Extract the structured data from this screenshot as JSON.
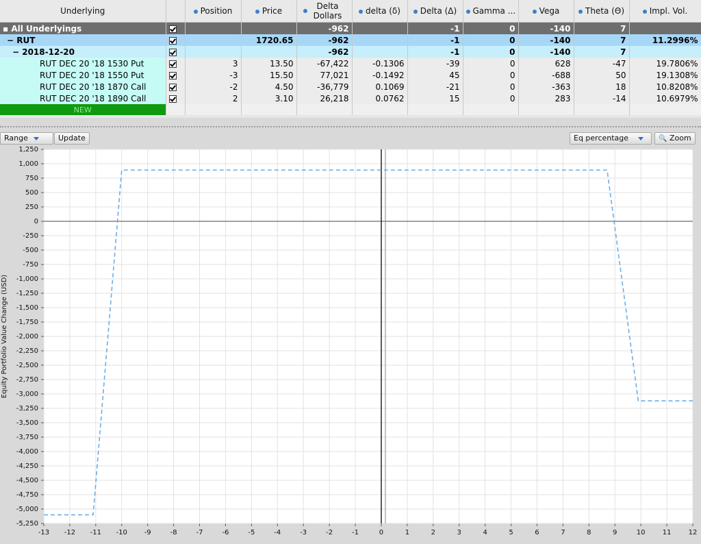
{
  "columns": [
    "Underlying",
    "",
    "Position",
    "Price",
    "Delta Dollars",
    "delta (δ)",
    "Delta (Δ)",
    "Gamma ...",
    "Vega",
    "Theta (Θ)",
    "Impl. Vol."
  ],
  "rows": {
    "all": {
      "label": "All Underlyings",
      "position": "",
      "price": "",
      "delta_dollars": "-962",
      "delta_small": "",
      "delta_cap": "-1",
      "gamma": "0",
      "vega": "-140",
      "theta": "7",
      "iv": ""
    },
    "rut": {
      "label": "RUT",
      "position": "",
      "price": "1720.65",
      "delta_dollars": "-962",
      "delta_small": "",
      "delta_cap": "-1",
      "gamma": "0",
      "vega": "-140",
      "theta": "7",
      "iv": "11.2996%"
    },
    "expiry": {
      "label": "2018-12-20",
      "position": "",
      "price": "",
      "delta_dollars": "-962",
      "delta_small": "",
      "delta_cap": "-1",
      "gamma": "0",
      "vega": "-140",
      "theta": "7",
      "iv": ""
    },
    "legs": [
      {
        "label": "RUT DEC 20 '18 1530 Put",
        "position": "3",
        "price": "13.50",
        "delta_dollars": "-67,422",
        "delta_small": "-0.1306",
        "delta_cap": "-39",
        "gamma": "0",
        "vega": "628",
        "theta": "-47",
        "iv": "19.7806%"
      },
      {
        "label": "RUT DEC 20 '18 1550 Put",
        "position": "-3",
        "price": "15.50",
        "delta_dollars": "77,021",
        "delta_small": "-0.1492",
        "delta_cap": "45",
        "gamma": "0",
        "vega": "-688",
        "theta": "50",
        "iv": "19.1308%"
      },
      {
        "label": "RUT DEC 20 '18 1870 Call",
        "position": "-2",
        "price": "4.50",
        "delta_dollars": "-36,779",
        "delta_small": "0.1069",
        "delta_cap": "-21",
        "gamma": "0",
        "vega": "-363",
        "theta": "18",
        "iv": "10.8208%"
      },
      {
        "label": "RUT DEC 20 '18 1890 Call",
        "position": "2",
        "price": "3.10",
        "delta_dollars": "26,218",
        "delta_small": "0.0762",
        "delta_cap": "15",
        "gamma": "0",
        "vega": "283",
        "theta": "-14",
        "iv": "10.6979%"
      }
    ],
    "new_label": "NEW"
  },
  "toolbar": {
    "range_label": "Range",
    "update_label": "Update",
    "mode_label": "Eq percentage",
    "zoom_label": "Zoom"
  },
  "chart_data": {
    "type": "line",
    "ylabel": "Equity Portfolio Value Change (USD)",
    "xlabel": "",
    "xlim": [
      -13,
      12
    ],
    "ylim": [
      -5250,
      1250
    ],
    "xticks": [
      -13,
      -12,
      -11,
      -10,
      -9,
      -8,
      -7,
      -6,
      -5,
      -4,
      -3,
      -2,
      -1,
      0,
      1,
      2,
      3,
      4,
      5,
      6,
      7,
      8,
      9,
      10,
      11,
      12
    ],
    "yticks": [
      1250,
      1000,
      750,
      500,
      250,
      0,
      -250,
      -500,
      -750,
      -1000,
      -1250,
      -1500,
      -1750,
      -2000,
      -2250,
      -2500,
      -2750,
      -3000,
      -3250,
      -3500,
      -3750,
      -4000,
      -4250,
      -4500,
      -4750,
      -5000,
      -5250
    ],
    "series": [
      {
        "x": [
          -13,
          -11.1,
          -10,
          8.7,
          9.9,
          12
        ],
        "y": [
          -5100,
          -5100,
          890,
          890,
          -3120,
          -3120
        ]
      }
    ],
    "current_line_x": 0,
    "line_color": "#6aaee8"
  }
}
